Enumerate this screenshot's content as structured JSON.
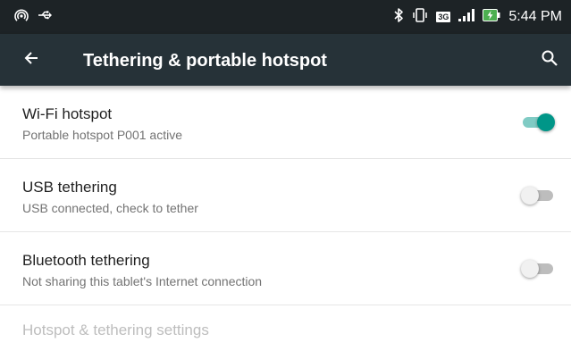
{
  "status_bar": {
    "time": "5:44 PM",
    "network_badge": "3G",
    "icons": [
      "hotspot-icon",
      "usb-icon",
      "bluetooth-icon",
      "vibrate-icon",
      "signal-icon",
      "battery-charging-icon"
    ]
  },
  "app_bar": {
    "title": "Tethering & portable hotspot",
    "back_icon": "arrow-back-icon",
    "search_icon": "search-icon"
  },
  "settings": [
    {
      "title": "Wi-Fi hotspot",
      "subtitle": "Portable hotspot P001 active",
      "enabled": true
    },
    {
      "title": "USB tethering",
      "subtitle": "USB connected, check to tether",
      "enabled": false
    },
    {
      "title": "Bluetooth tethering",
      "subtitle": "Not sharing this tablet's Internet connection",
      "enabled": false
    }
  ],
  "footer_item": {
    "title": "Hotspot & tethering settings",
    "disabled": true
  },
  "colors": {
    "status_bar": "#1d2326",
    "app_bar": "#263238",
    "accent": "#009688",
    "accent_track": "#80cbc4",
    "battery": "#4caf50"
  }
}
